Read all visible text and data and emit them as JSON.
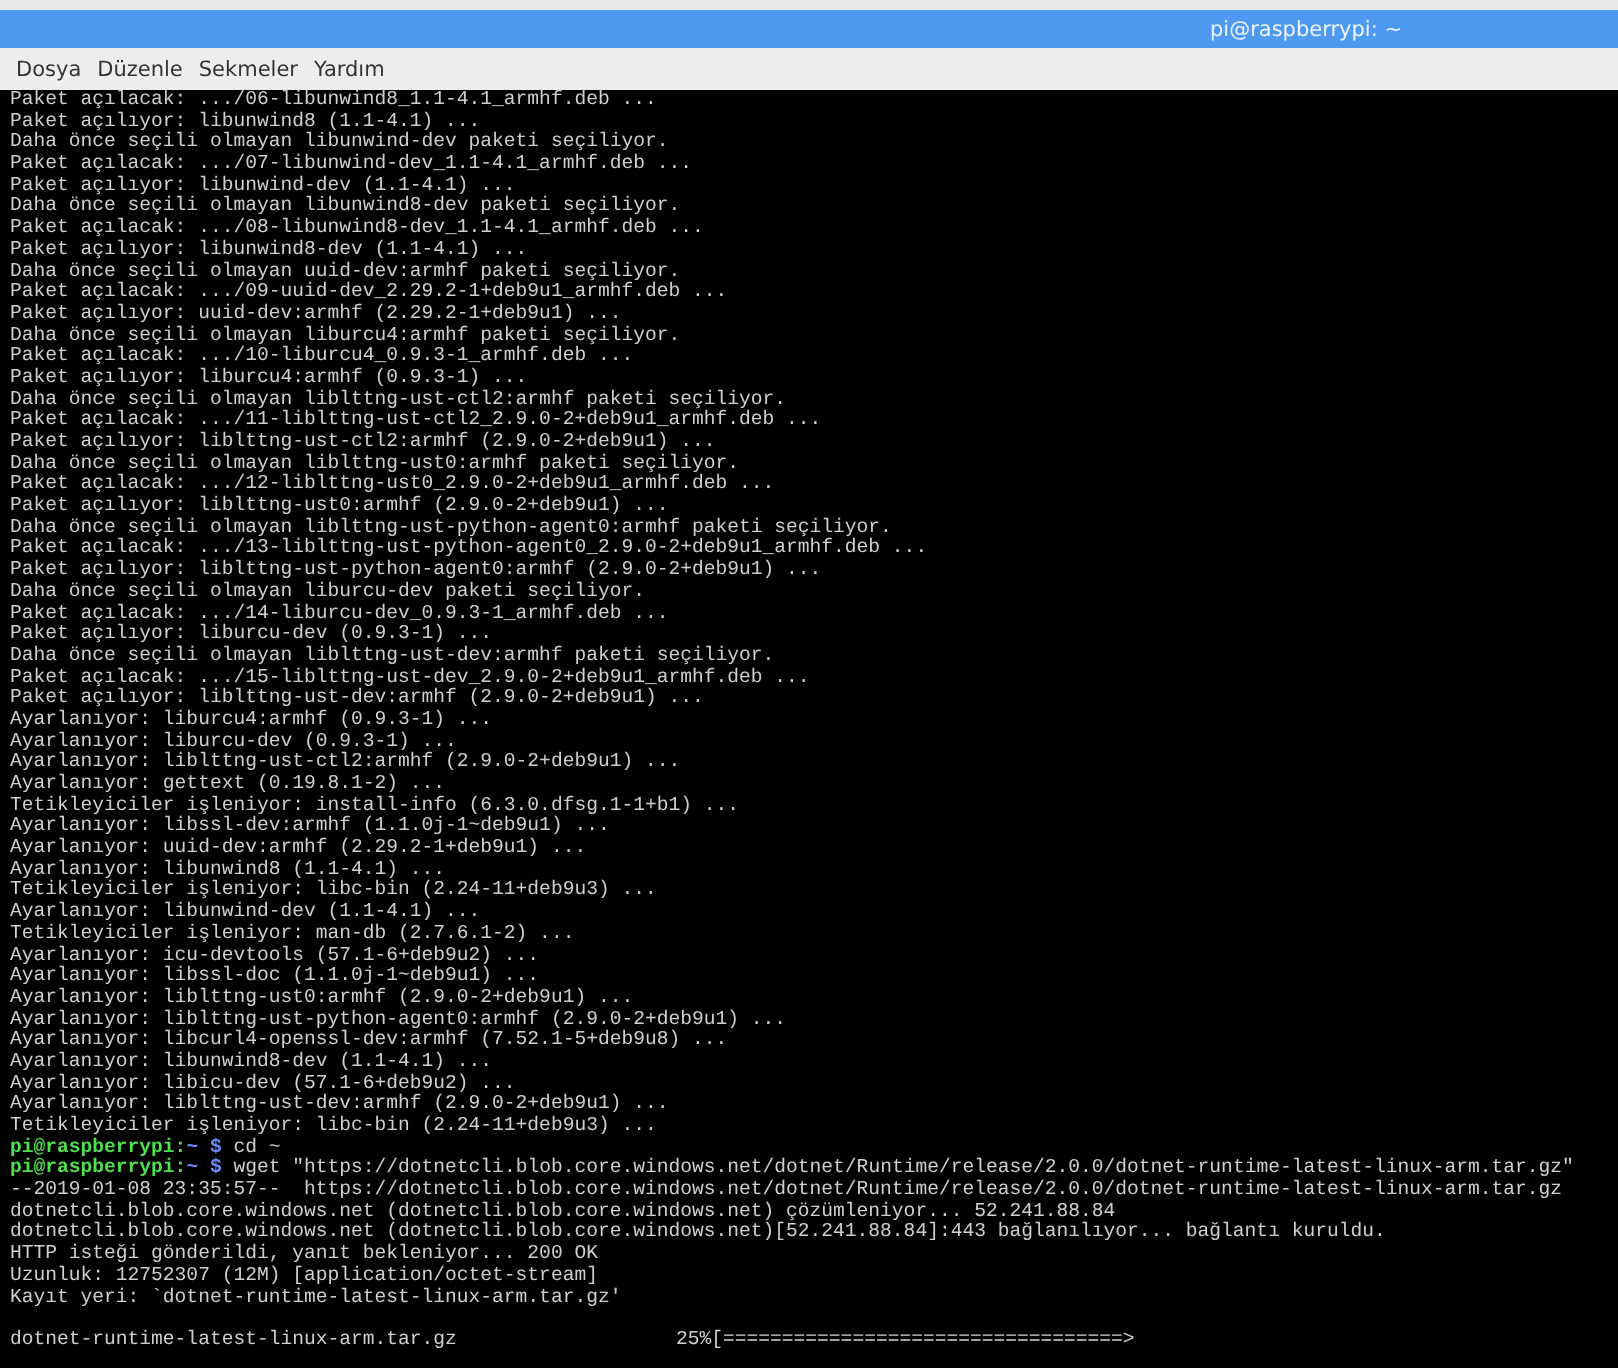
{
  "window": {
    "title": "pi@raspberrypi: ~"
  },
  "menu": [
    {
      "label": "Dosya"
    },
    {
      "label": "Düzenle"
    },
    {
      "label": "Sekmeler"
    },
    {
      "label": "Yardım"
    }
  ],
  "terminal": {
    "lines": [
      {
        "kind": "output",
        "text": "Paket açılacak: .../06-libunwind8_1.1-4.1_armhf.deb ..."
      },
      {
        "kind": "output",
        "text": "Paket açılıyor: libunwind8 (1.1-4.1) ..."
      },
      {
        "kind": "output",
        "text": "Daha önce seçili olmayan libunwind-dev paketi seçiliyor."
      },
      {
        "kind": "output",
        "text": "Paket açılacak: .../07-libunwind-dev_1.1-4.1_armhf.deb ..."
      },
      {
        "kind": "output",
        "text": "Paket açılıyor: libunwind-dev (1.1-4.1) ..."
      },
      {
        "kind": "output",
        "text": "Daha önce seçili olmayan libunwind8-dev paketi seçiliyor."
      },
      {
        "kind": "output",
        "text": "Paket açılacak: .../08-libunwind8-dev_1.1-4.1_armhf.deb ..."
      },
      {
        "kind": "output",
        "text": "Paket açılıyor: libunwind8-dev (1.1-4.1) ..."
      },
      {
        "kind": "output",
        "text": "Daha önce seçili olmayan uuid-dev:armhf paketi seçiliyor."
      },
      {
        "kind": "output",
        "text": "Paket açılacak: .../09-uuid-dev_2.29.2-1+deb9u1_armhf.deb ..."
      },
      {
        "kind": "output",
        "text": "Paket açılıyor: uuid-dev:armhf (2.29.2-1+deb9u1) ..."
      },
      {
        "kind": "output",
        "text": "Daha önce seçili olmayan liburcu4:armhf paketi seçiliyor."
      },
      {
        "kind": "output",
        "text": "Paket açılacak: .../10-liburcu4_0.9.3-1_armhf.deb ..."
      },
      {
        "kind": "output",
        "text": "Paket açılıyor: liburcu4:armhf (0.9.3-1) ..."
      },
      {
        "kind": "output",
        "text": "Daha önce seçili olmayan liblttng-ust-ctl2:armhf paketi seçiliyor."
      },
      {
        "kind": "output",
        "text": "Paket açılacak: .../11-liblttng-ust-ctl2_2.9.0-2+deb9u1_armhf.deb ..."
      },
      {
        "kind": "output",
        "text": "Paket açılıyor: liblttng-ust-ctl2:armhf (2.9.0-2+deb9u1) ..."
      },
      {
        "kind": "output",
        "text": "Daha önce seçili olmayan liblttng-ust0:armhf paketi seçiliyor."
      },
      {
        "kind": "output",
        "text": "Paket açılacak: .../12-liblttng-ust0_2.9.0-2+deb9u1_armhf.deb ..."
      },
      {
        "kind": "output",
        "text": "Paket açılıyor: liblttng-ust0:armhf (2.9.0-2+deb9u1) ..."
      },
      {
        "kind": "output",
        "text": "Daha önce seçili olmayan liblttng-ust-python-agent0:armhf paketi seçiliyor."
      },
      {
        "kind": "output",
        "text": "Paket açılacak: .../13-liblttng-ust-python-agent0_2.9.0-2+deb9u1_armhf.deb ..."
      },
      {
        "kind": "output",
        "text": "Paket açılıyor: liblttng-ust-python-agent0:armhf (2.9.0-2+deb9u1) ..."
      },
      {
        "kind": "output",
        "text": "Daha önce seçili olmayan liburcu-dev paketi seçiliyor."
      },
      {
        "kind": "output",
        "text": "Paket açılacak: .../14-liburcu-dev_0.9.3-1_armhf.deb ..."
      },
      {
        "kind": "output",
        "text": "Paket açılıyor: liburcu-dev (0.9.3-1) ..."
      },
      {
        "kind": "output",
        "text": "Daha önce seçili olmayan liblttng-ust-dev:armhf paketi seçiliyor."
      },
      {
        "kind": "output",
        "text": "Paket açılacak: .../15-liblttng-ust-dev_2.9.0-2+deb9u1_armhf.deb ..."
      },
      {
        "kind": "output",
        "text": "Paket açılıyor: liblttng-ust-dev:armhf (2.9.0-2+deb9u1) ..."
      },
      {
        "kind": "output",
        "text": "Ayarlanıyor: liburcu4:armhf (0.9.3-1) ..."
      },
      {
        "kind": "output",
        "text": "Ayarlanıyor: liburcu-dev (0.9.3-1) ..."
      },
      {
        "kind": "output",
        "text": "Ayarlanıyor: liblttng-ust-ctl2:armhf (2.9.0-2+deb9u1) ..."
      },
      {
        "kind": "output",
        "text": "Ayarlanıyor: gettext (0.19.8.1-2) ..."
      },
      {
        "kind": "output",
        "text": "Tetikleyiciler işleniyor: install-info (6.3.0.dfsg.1-1+b1) ..."
      },
      {
        "kind": "output",
        "text": "Ayarlanıyor: libssl-dev:armhf (1.1.0j-1~deb9u1) ..."
      },
      {
        "kind": "output",
        "text": "Ayarlanıyor: uuid-dev:armhf (2.29.2-1+deb9u1) ..."
      },
      {
        "kind": "output",
        "text": "Ayarlanıyor: libunwind8 (1.1-4.1) ..."
      },
      {
        "kind": "output",
        "text": "Tetikleyiciler işleniyor: libc-bin (2.24-11+deb9u3) ..."
      },
      {
        "kind": "output",
        "text": "Ayarlanıyor: libunwind-dev (1.1-4.1) ..."
      },
      {
        "kind": "output",
        "text": "Tetikleyiciler işleniyor: man-db (2.7.6.1-2) ..."
      },
      {
        "kind": "output",
        "text": "Ayarlanıyor: icu-devtools (57.1-6+deb9u2) ..."
      },
      {
        "kind": "output",
        "text": "Ayarlanıyor: libssl-doc (1.1.0j-1~deb9u1) ..."
      },
      {
        "kind": "output",
        "text": "Ayarlanıyor: liblttng-ust0:armhf (2.9.0-2+deb9u1) ..."
      },
      {
        "kind": "output",
        "text": "Ayarlanıyor: liblttng-ust-python-agent0:armhf (2.9.0-2+deb9u1) ..."
      },
      {
        "kind": "output",
        "text": "Ayarlanıyor: libcurl4-openssl-dev:armhf (7.52.1-5+deb9u8) ..."
      },
      {
        "kind": "output",
        "text": "Ayarlanıyor: libunwind8-dev (1.1-4.1) ..."
      },
      {
        "kind": "output",
        "text": "Ayarlanıyor: libicu-dev (57.1-6+deb9u2) ..."
      },
      {
        "kind": "output",
        "text": "Ayarlanıyor: liblttng-ust-dev:armhf (2.9.0-2+deb9u1) ..."
      },
      {
        "kind": "output",
        "text": "Tetikleyiciler işleniyor: libc-bin (2.24-11+deb9u3) ..."
      },
      {
        "kind": "prompt",
        "user_host": "pi@raspberrypi:",
        "path": "~ $",
        "command": "cd ~"
      },
      {
        "kind": "prompt",
        "user_host": "pi@raspberrypi:",
        "path": "~ $",
        "command": "wget \"https://dotnetcli.blob.core.windows.net/dotnet/Runtime/release/2.0.0/dotnet-runtime-latest-linux-arm.tar.gz\""
      },
      {
        "kind": "output",
        "text": "--2019-01-08 23:35:57--  https://dotnetcli.blob.core.windows.net/dotnet/Runtime/release/2.0.0/dotnet-runtime-latest-linux-arm.tar.gz"
      },
      {
        "kind": "output",
        "text": "dotnetcli.blob.core.windows.net (dotnetcli.blob.core.windows.net) çözümleniyor... 52.241.88.84"
      },
      {
        "kind": "output",
        "text": "dotnetcli.blob.core.windows.net (dotnetcli.blob.core.windows.net)[52.241.88.84]:443 bağlanılıyor... bağlantı kuruldu."
      },
      {
        "kind": "output",
        "text": "HTTP isteği gönderildi, yanıt bekleniyor... 200 OK"
      },
      {
        "kind": "output",
        "text": "Uzunluk: 12752307 (12M) [application/octet-stream]"
      },
      {
        "kind": "output",
        "text": "Kayıt yeri: `dotnet-runtime-latest-linux-arm.tar.gz'"
      },
      {
        "kind": "blank"
      },
      {
        "kind": "progress",
        "file": "dotnet-runtime-latest-linux-arm.tar.gz",
        "percent": "25%",
        "bar": "[==================================>"
      }
    ]
  }
}
